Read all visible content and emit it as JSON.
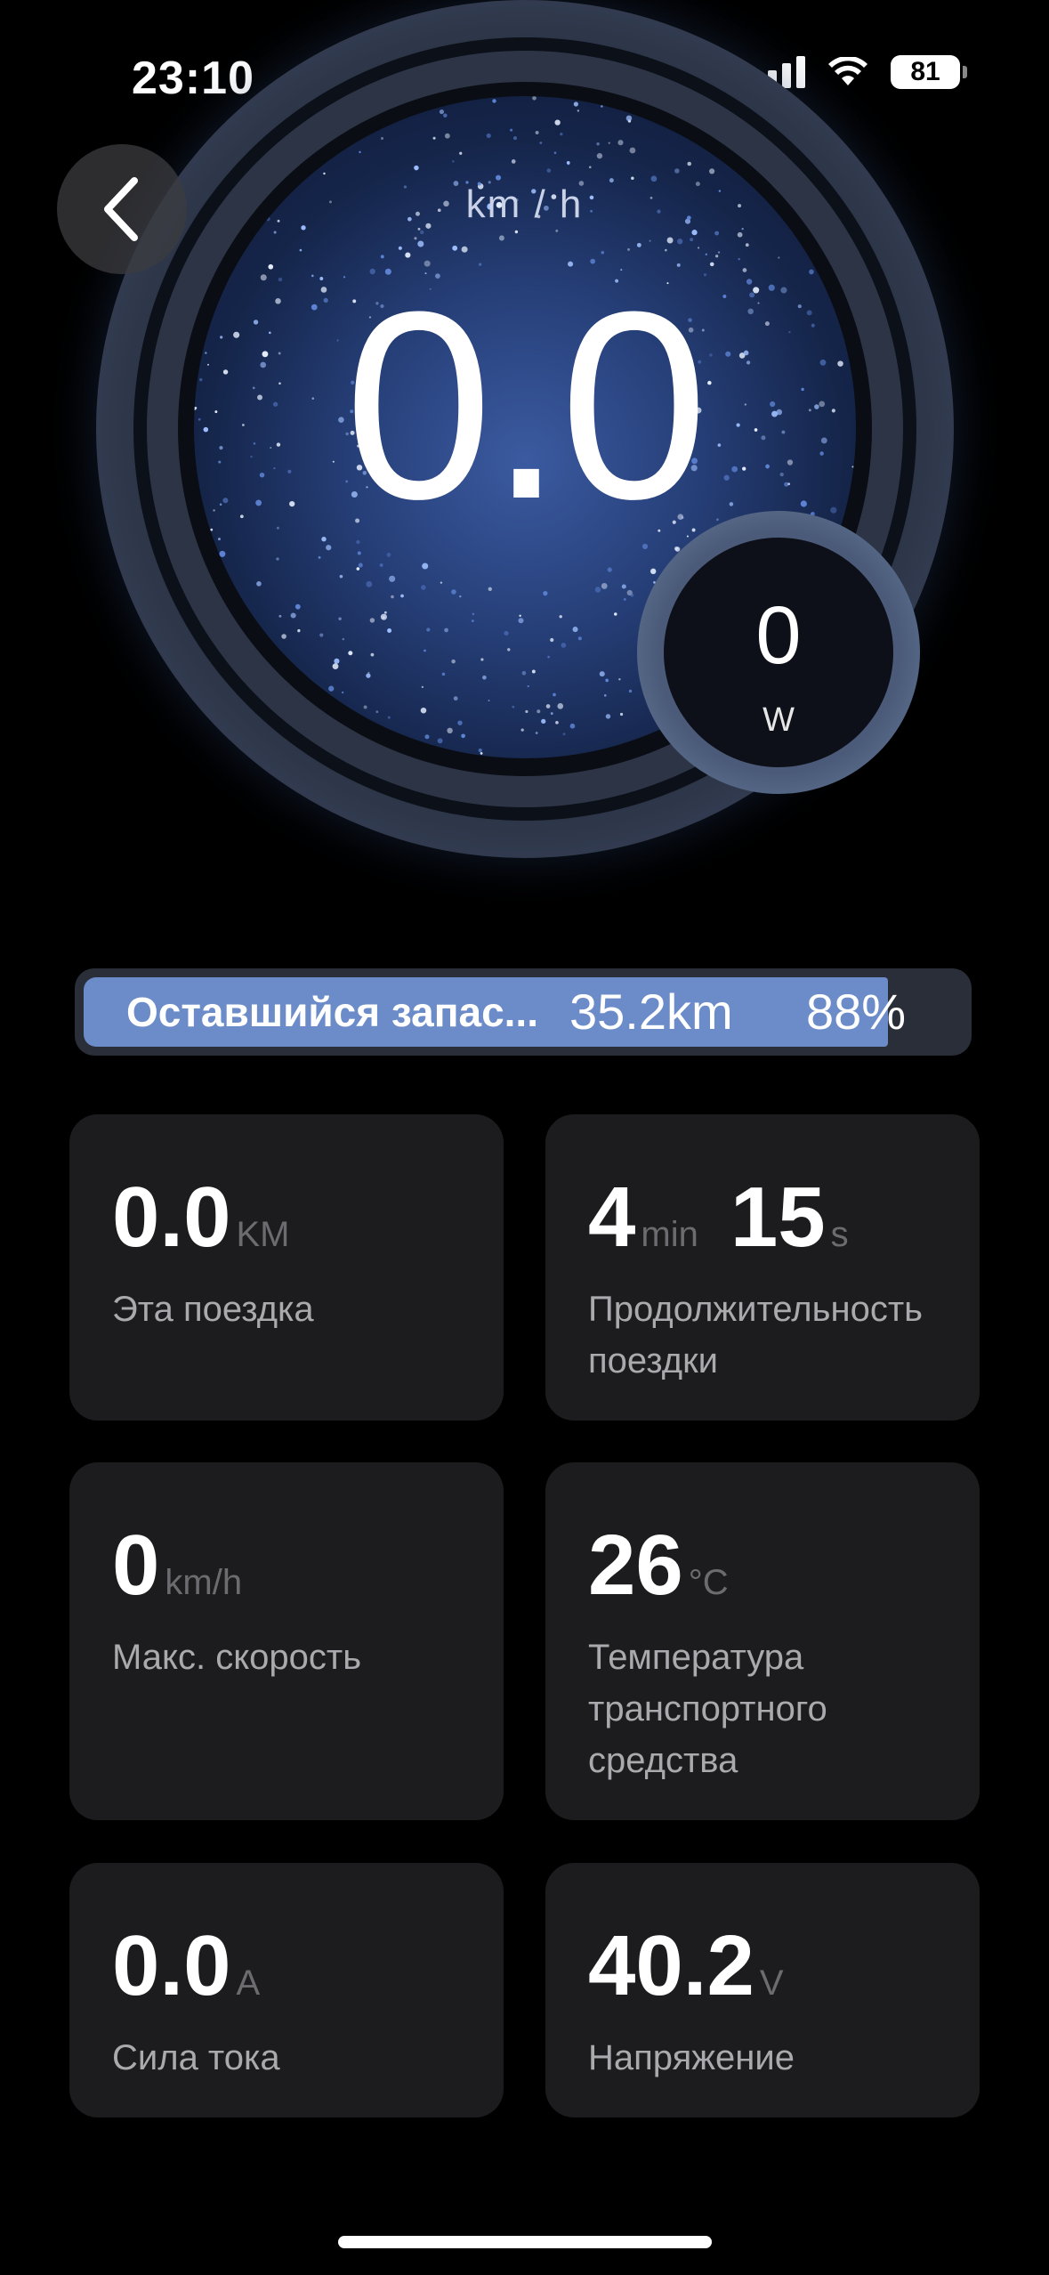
{
  "status_bar": {
    "time": "23:10",
    "battery": "81"
  },
  "gauge": {
    "speed_unit": "km / h",
    "speed": "0.0",
    "power_value": "0",
    "power_unit": "W"
  },
  "range": {
    "label": "Оставшийся запас...",
    "distance": "35.2km",
    "percent_text": "88%",
    "percent": 0.88,
    "fill_color": "#6b8cc9"
  },
  "cards": {
    "trip": {
      "value": "0.0",
      "unit": "KM",
      "label": "Эта поездка"
    },
    "duration": {
      "min_value": "4",
      "min_unit": "min",
      "sec_value": "15",
      "sec_unit": "s",
      "label": "Продолжительность поездки"
    },
    "max_speed": {
      "value": "0",
      "unit": "km/h",
      "label": "Макс. скорость"
    },
    "temperature": {
      "value": "26",
      "unit": "°C",
      "label": "Температура транспортного средства"
    },
    "current": {
      "value": "0.0",
      "unit": "A",
      "label": "Сила тока"
    },
    "voltage": {
      "value": "40.2",
      "unit": "V",
      "label": "Напряжение"
    }
  },
  "icons": {
    "back": "chevron-left-icon",
    "signal": "cellular-signal-icon",
    "wifi": "wifi-icon",
    "battery": "battery-icon"
  }
}
